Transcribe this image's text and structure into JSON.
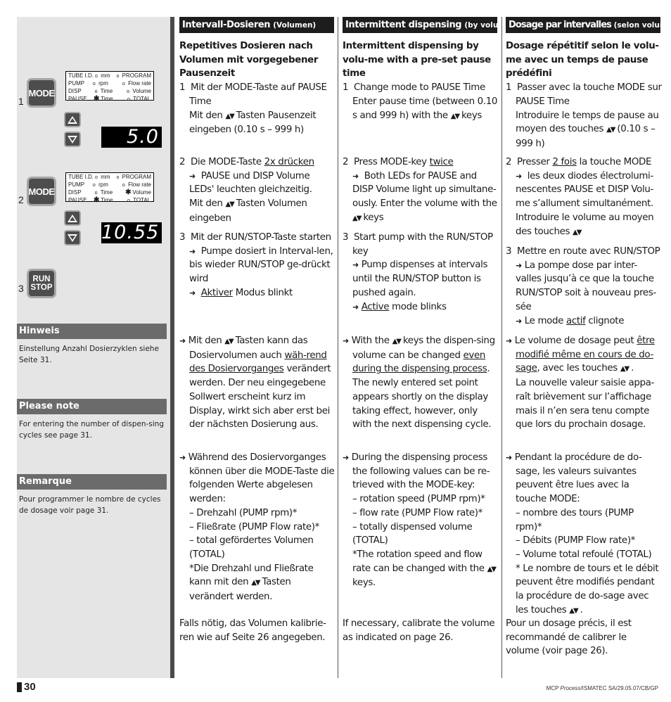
{
  "sidebar": {
    "step1": {
      "number": "1",
      "mode_key": "MODE",
      "panel": {
        "rows": [
          {
            "label": "TUBE I.D.",
            "led1": "o",
            "val1": "mm",
            "led2": "o",
            "val2": "PROGRAM"
          },
          {
            "label": "PUMP",
            "led1": "o",
            "val1": "rpm",
            "led2": "o",
            "val2": "Flow rate"
          },
          {
            "label": "DISP",
            "led1": "o",
            "val1": "Time",
            "led2": "o",
            "val2": "Volume"
          },
          {
            "label": "PAUSE",
            "led1": "✱",
            "val1": "Time",
            "led2": "o",
            "val2": "TOTAL"
          }
        ]
      },
      "display_value": "5.0"
    },
    "step2": {
      "number": "2",
      "mode_key": "MODE",
      "panel": {
        "rows": [
          {
            "label": "TUBE I.D.",
            "led1": "o",
            "val1": "mm",
            "led2": "o",
            "val2": "PROGRAM"
          },
          {
            "label": "PUMP",
            "led1": "o",
            "val1": "rpm",
            "led2": "o",
            "val2": "Flow rate"
          },
          {
            "label": "DISP",
            "led1": "o",
            "val1": "Time",
            "led2": "✱",
            "val2": "Volume"
          },
          {
            "label": "PAUSE",
            "led1": "✱",
            "val1": "Time",
            "led2": "o",
            "val2": "TOTAL"
          }
        ]
      },
      "display_value": "10.55"
    },
    "step3": {
      "number": "3",
      "run_label": "RUN",
      "stop_label": "STOP"
    },
    "notes": [
      {
        "title": "Hinweis",
        "text": "Einstellung Anzahl Dosierzyklen siehe Seite 31."
      },
      {
        "title": "Please note",
        "text": "For entering the number of dispen-sing cycles see page 31."
      },
      {
        "title": "Remarque",
        "text": "Pour programmer le nombre de cycles de dosage voir page 31."
      }
    ]
  },
  "columns": {
    "de": {
      "heading": "Intervall-Dosieren",
      "heading_sub": "(Volumen)",
      "title": "Repetitives Dosieren nach Volumen mit vorgegebener Pausenzeit",
      "step1_num": "1",
      "step1_a": "Mit der MODE-Taste auf PAUSE Time",
      "step1_b1": "Mit den",
      "step1_b2": "Tasten Pausenzeit eingeben (0.10 s – 999 h)",
      "step2_num": "2",
      "step2_a": "Die MODE-Taste",
      "step2_a_u": "2x drücken",
      "step2_b": "PAUSE und DISP Volume LEDs' leuchten gleichzeitig.",
      "step2_c1": "Mit den",
      "step2_c2": "Tasten Volumen eingeben",
      "step3_num": "3",
      "step3_a": "Mit der RUN/STOP-Taste starten",
      "step3_b": "Pumpe dosiert in Interval-len, bis wieder RUN/STOP ge-drückt wird",
      "step3_c_u": "Aktiver",
      "step3_c": "Modus blinkt",
      "change_1": "Mit den",
      "change_2": "Tasten kann das Dosiervolumen auch",
      "change_u": "wäh-rend des Dosiervorganges",
      "change_3": "verändert werden. Der neu eingegebene Sollwert erscheint kurz im Display,  wirkt sich aber erst bei der nächsten Dosierung aus.",
      "read_intro": "Während des Dosiervorganges können über die MODE-Taste die folgenden Werte abgelesen werden:",
      "read_items": [
        "– Drehzahl (PUMP rpm)*",
        "– Fließrate (PUMP Flow rate)*",
        "– total gefördertes Volumen (TOTAL)"
      ],
      "read_note1": "*Die Drehzahl und Fließrate kann mit den",
      "read_note2": "Tasten verändert werden.",
      "calibrate": "Falls nötig, das Volumen kalibrie-ren wie auf Seite 26 angegeben."
    },
    "en": {
      "heading": "Intermittent dispensing",
      "heading_sub": "(by volume)",
      "title": "Intermittent dispensing by volu-me with a pre-set pause time",
      "step1_num": "1",
      "step1_a": "Change mode to PAUSE Time",
      "step1_b1": "Enter pause time (between 0.10 s and 999 h) with the",
      "step1_b2": "keys",
      "step2_num": "2",
      "step2_a": "Press MODE-key",
      "step2_a_u": "twice",
      "step2_b": "Both LEDs for PAUSE and DISP Volume light up simultane-ously. Enter the volume  with the",
      "step2_c2": "keys",
      "step3_num": "3",
      "step3_a": "Start pump with the RUN/STOP key",
      "step3_b": "Pump dispenses at intervals until the RUN/STOP button is pushed again.",
      "step3_c_u": "Active",
      "step3_c": "mode blinks",
      "change_1": "With the",
      "change_2": "keys the dispen-sing volume can be changed",
      "change_u": "even during the dispensing process",
      "change_3": ". The newly entered set point appears shortly on the display taking effect, however, only with the next dispensing cycle.",
      "read_intro": "During the dispensing process the following values can be re-trieved with the MODE-key:",
      "read_items": [
        "– rotation speed (PUMP rpm)*",
        "– flow rate (PUMP Flow rate)*",
        "– totally dispensed volume (TOTAL)"
      ],
      "read_note1": "*The rotation speed and flow rate can be changed with the",
      "read_note2": "keys.",
      "calibrate": "If necessary, calibrate the volume as indicated on page 26."
    },
    "fr": {
      "heading": "Dosage par intervalles",
      "heading_sub": "(selon volume)",
      "title": "Dosage répétitif selon le volu-me avec un temps de pause prédéfini",
      "step1_num": "1",
      "step1_a": "Passer avec la touche MODE sur PAUSE Time",
      "step1_b1": "Introduire le temps de pause au moyen des touches",
      "step1_b2": "(0.10 s – 999 h)",
      "step2_num": "2",
      "step2_a": "Presser",
      "step2_a_u": "2 fois",
      "step2_a2": "la touche MODE",
      "step2_b": "les deux diodes électrolumi-nescentes PAUSE et DISP Volu-me s’allument simultanément.",
      "step2_c1": "Introduire le volume au moyen des touches",
      "step3_num": "3",
      "step3_a": "Mettre en route avec RUN/STOP",
      "step3_b": "La pompe dose par inter-valles jusqu’à ce que la touche RUN/STOP soit à nouveau  pres-sée",
      "step3_c_pre": "Le mode",
      "step3_c_u": "actif",
      "step3_c": "clignote",
      "change_1": "Le volume de dosage peut",
      "change_u": "être modifié même en cours de do-sage",
      "change_2": ", avec les touches",
      "change_3": "La nouvelle valeur saisie appa-raît brièvement sur l’affichage mais il n’en sera tenu compte que lors du prochain dosage.",
      "read_intro": "Pendant la procédure de  do-sage, les valeurs suivantes peuvent être lues avec la touche MODE:",
      "read_items": [
        "– nombre des tours (PUMP rpm)*",
        "– Débits (PUMP Flow rate)*",
        "– Volume total refoulé (TOTAL)"
      ],
      "read_note1": "* Le nombre de tours et le débit peuvent être modifiés pendant la procédure de do-sage avec les touches",
      "calibrate": "Pour un dosage précis, il est recommandé de calibrer le volume (voir page 26)."
    }
  },
  "icons": {
    "arrow": "➜",
    "updown": "▲▼"
  },
  "footer": {
    "page_number": "30",
    "ref_prefix": "MCP ",
    "ref_italic": "Process",
    "ref_suffix": "/ISMATEC SA/29.05.07/CB/GP"
  }
}
